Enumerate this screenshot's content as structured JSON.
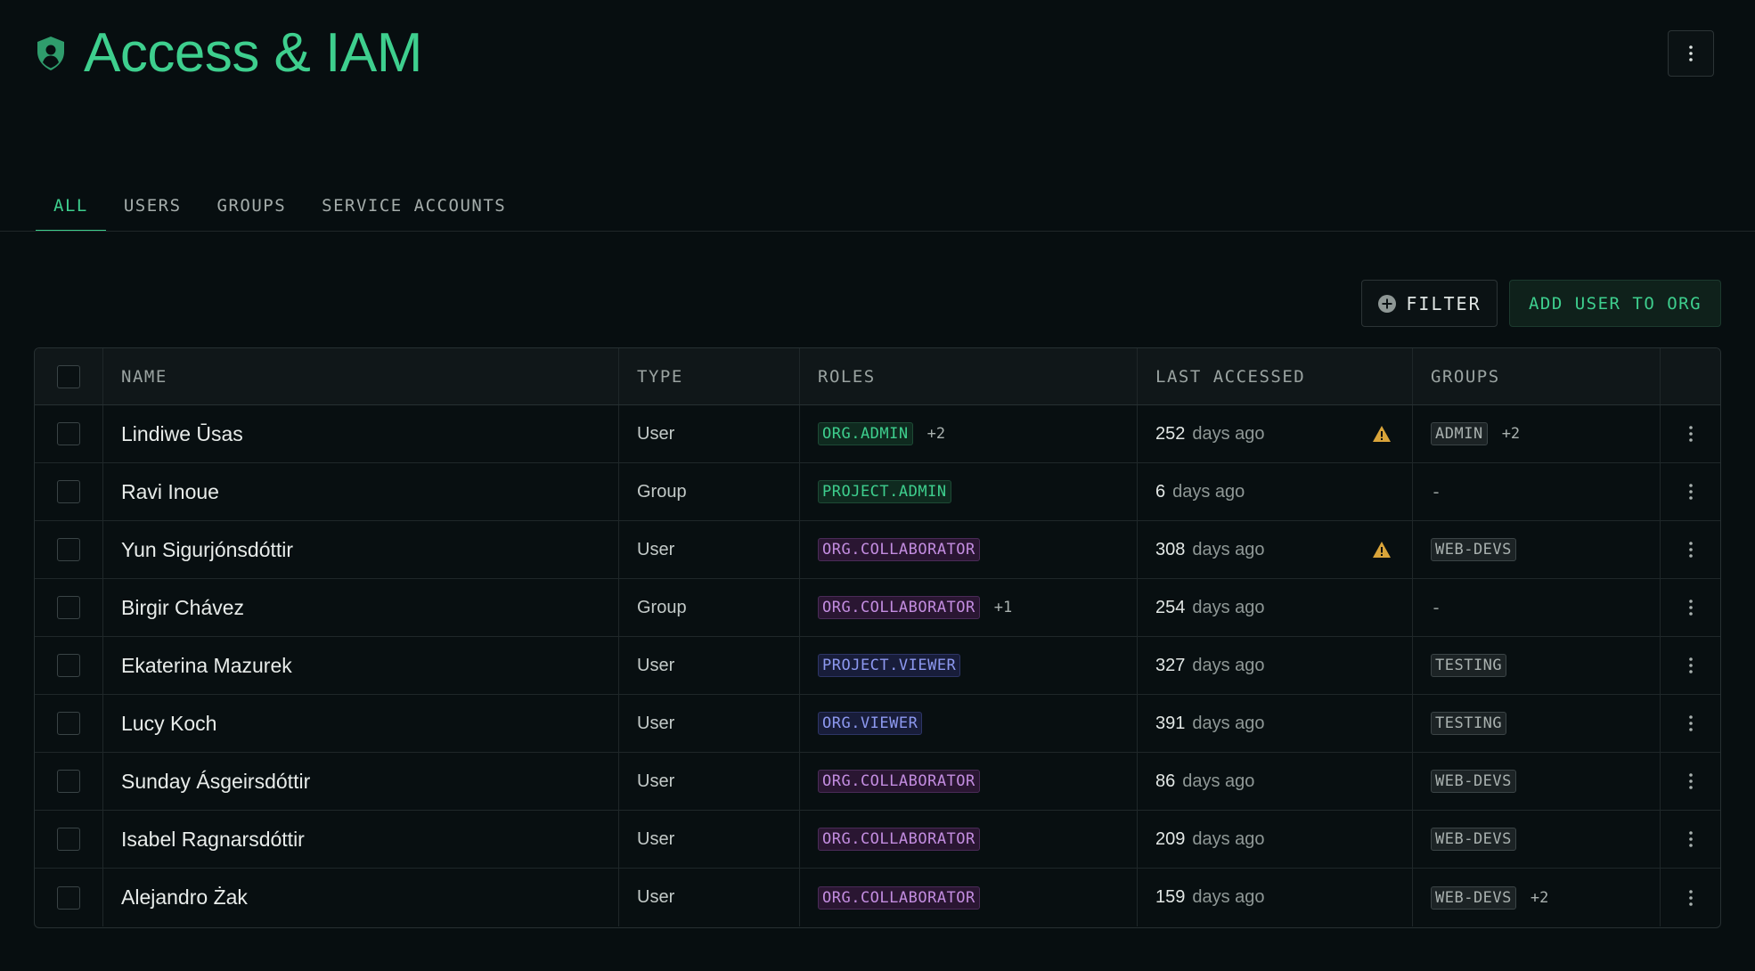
{
  "header": {
    "title": "Access & IAM"
  },
  "tabs": [
    {
      "label": "ALL",
      "active": true
    },
    {
      "label": "USERS",
      "active": false
    },
    {
      "label": "GROUPS",
      "active": false
    },
    {
      "label": "SERVICE ACCOUNTS",
      "active": false
    }
  ],
  "toolbar": {
    "filter_label": "FILTER",
    "add_label": "ADD USER TO ORG"
  },
  "table": {
    "columns": {
      "name": "NAME",
      "type": "TYPE",
      "roles": "ROLES",
      "last": "LAST ACCESSED",
      "groups": "GROUPS"
    },
    "rows": [
      {
        "name": "Lindiwe Ūsas",
        "type": "User",
        "role": "ORG.ADMIN",
        "role_color": "green",
        "role_more": "+2",
        "days": "252",
        "days_suffix": "days ago",
        "warning": true,
        "group": "ADMIN",
        "group_more": "+2"
      },
      {
        "name": "Ravi Inoue",
        "type": "Group",
        "role": "PROJECT.ADMIN",
        "role_color": "green",
        "role_more": "",
        "days": "6",
        "days_suffix": "days ago",
        "warning": false,
        "group": "",
        "group_empty": "-",
        "group_more": ""
      },
      {
        "name": "Yun Sigurjónsdóttir",
        "type": "User",
        "role": "ORG.COLLABORATOR",
        "role_color": "purple",
        "role_more": "",
        "days": "308",
        "days_suffix": "days ago",
        "warning": true,
        "group": "WEB-DEVS",
        "group_more": ""
      },
      {
        "name": "Birgir Chávez",
        "type": "Group",
        "role": "ORG.COLLABORATOR",
        "role_color": "purple",
        "role_more": "+1",
        "days": "254",
        "days_suffix": "days ago",
        "warning": false,
        "group": "",
        "group_empty": "-",
        "group_more": ""
      },
      {
        "name": "Ekaterina Mazurek",
        "type": "User",
        "role": "PROJECT.VIEWER",
        "role_color": "blue",
        "role_more": "",
        "days": "327",
        "days_suffix": "days ago",
        "warning": false,
        "group": "TESTING",
        "group_more": ""
      },
      {
        "name": "Lucy Koch",
        "type": "User",
        "role": "ORG.VIEWER",
        "role_color": "blue",
        "role_more": "",
        "days": "391",
        "days_suffix": "days ago",
        "warning": false,
        "group": "TESTING",
        "group_more": ""
      },
      {
        "name": "Sunday Ásgeirsdóttir",
        "type": "User",
        "role": "ORG.COLLABORATOR",
        "role_color": "purple",
        "role_more": "",
        "days": "86",
        "days_suffix": "days ago",
        "warning": false,
        "group": "WEB-DEVS",
        "group_more": ""
      },
      {
        "name": "Isabel Ragnarsdóttir",
        "type": "User",
        "role": "ORG.COLLABORATOR",
        "role_color": "purple",
        "role_more": "",
        "days": "209",
        "days_suffix": "days ago",
        "warning": false,
        "group": "WEB-DEVS",
        "group_more": ""
      },
      {
        "name": "Alejandro Żak",
        "type": "User",
        "role": "ORG.COLLABORATOR",
        "role_color": "purple",
        "role_more": "",
        "days": "159",
        "days_suffix": "days ago",
        "warning": false,
        "group": "WEB-DEVS",
        "group_more": "+2"
      }
    ]
  },
  "colors": {
    "accent": "#3ecf8e",
    "warning": "#d9a43a",
    "background": "#070e10"
  },
  "icons": {
    "title": "shield-user-icon",
    "menu": "kebab-menu-icon",
    "filter": "plus-circle-icon",
    "warning": "warning-triangle-icon"
  }
}
